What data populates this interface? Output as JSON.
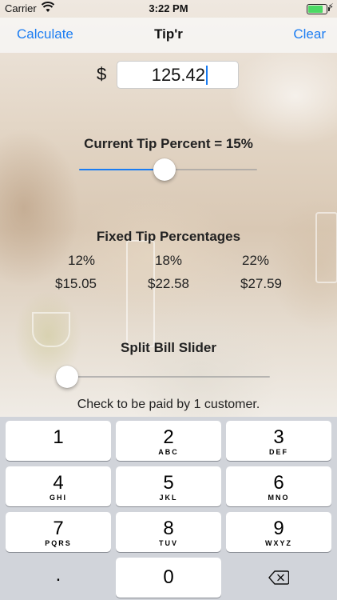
{
  "status_bar": {
    "carrier": "Carrier",
    "time": "3:22 PM",
    "wifi_icon": "wifi-icon",
    "battery_icon": "battery-icon",
    "charging_icon": "⚡"
  },
  "nav": {
    "left_button": "Calculate",
    "title": "Tip'r",
    "right_button": "Clear",
    "accent_color": "#1a7cf2"
  },
  "bill": {
    "currency_symbol": "$",
    "amount": "125.42"
  },
  "tip_slider": {
    "label": "Current Tip Percent = 15%",
    "value_fraction": 0.48
  },
  "fixed_tips": {
    "heading": "Fixed Tip Percentages",
    "options": [
      {
        "percent": "12%",
        "amount": "$15.05"
      },
      {
        "percent": "18%",
        "amount": "$22.58"
      },
      {
        "percent": "22%",
        "amount": "$27.59"
      }
    ]
  },
  "split": {
    "label": "Split Bill Slider",
    "value_fraction": 0.0,
    "message": "Check to be paid by 1 customer."
  },
  "keyboard": {
    "keys": [
      {
        "digit": "1",
        "letters": ""
      },
      {
        "digit": "2",
        "letters": "ABC"
      },
      {
        "digit": "3",
        "letters": "DEF"
      },
      {
        "digit": "4",
        "letters": "GHI"
      },
      {
        "digit": "5",
        "letters": "JKL"
      },
      {
        "digit": "6",
        "letters": "MNO"
      },
      {
        "digit": "7",
        "letters": "PQRS"
      },
      {
        "digit": "8",
        "letters": "TUV"
      },
      {
        "digit": "9",
        "letters": "WXYZ"
      }
    ],
    "decimal": ".",
    "zero": "0",
    "delete_icon": "backspace-icon"
  }
}
